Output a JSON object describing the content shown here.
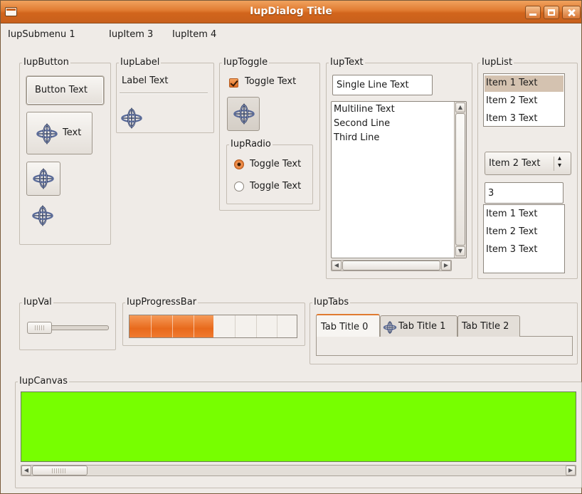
{
  "window": {
    "title": "IupDialog Title"
  },
  "menubar": {
    "items": [
      "IupSubmenu 1",
      "IupItem 3",
      "IupItem 4"
    ]
  },
  "frames": {
    "button": "IupButton",
    "label": "IupLabel",
    "toggle": "IupToggle",
    "radio": "IupRadio",
    "text": "IupText",
    "list": "IupList",
    "val": "IupVal",
    "progress": "IupProgressBar",
    "tabs": "IupTabs",
    "canvas": "IupCanvas"
  },
  "buttons": {
    "text_button": "Button Text",
    "icon_text_button": "Text"
  },
  "label": {
    "text": "Label Text"
  },
  "toggle": {
    "label": "Toggle Text",
    "checked": true
  },
  "radio": {
    "options": [
      "Toggle Text",
      "Toggle Text"
    ],
    "selected_index": 0
  },
  "text": {
    "single_line": "Single Line Text",
    "multiline": [
      "Multiline Text",
      "Second Line",
      "Third Line"
    ]
  },
  "list": {
    "items": [
      "Item 1 Text",
      "Item 2 Text",
      "Item 3 Text"
    ],
    "selected_index": 0,
    "dropdown_value": "Item 2 Text",
    "edit_value": "3",
    "edit_items": [
      "Item 1 Text",
      "Item 2 Text",
      "Item 3 Text"
    ]
  },
  "val": {
    "value": 0.0
  },
  "progress": {
    "value": 0.5
  },
  "tabs": {
    "titles": [
      "Tab Title 0",
      "Tab Title 1",
      "Tab Title 2"
    ],
    "active_index": 0
  },
  "canvas": {
    "color": "#77ff00"
  },
  "colors": {
    "titlebar_accent": "#e07a30",
    "window_bg": "#efebe7",
    "list_selection": "#d4c2b0",
    "progress_fill": "#e86a1c"
  },
  "icons": [
    "window-menu-icon",
    "minimize-icon",
    "maximize-icon",
    "close-icon",
    "iup-logo-icon",
    "checkmark-icon",
    "scroll-arrow-icon",
    "spin-arrows-icon"
  ]
}
